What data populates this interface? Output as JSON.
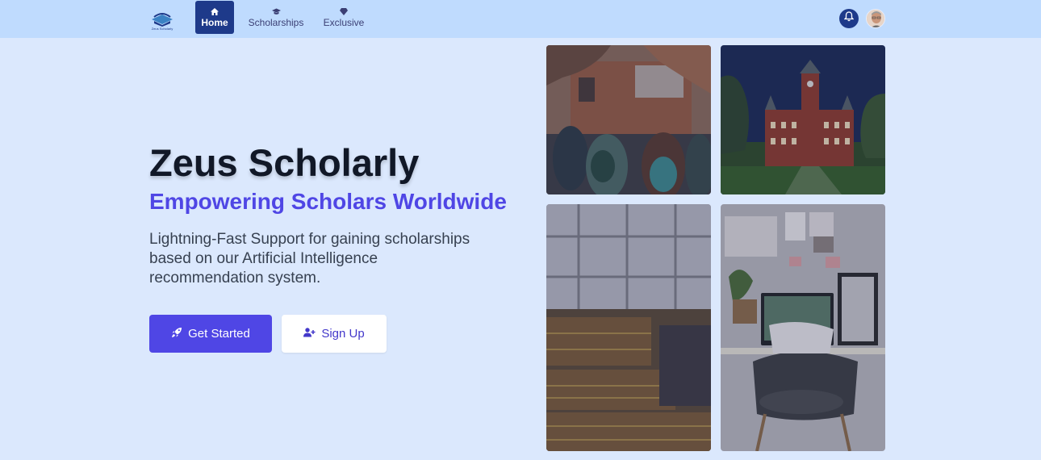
{
  "brand": {
    "logo_text": "Zeus Scholarly"
  },
  "nav": {
    "items": [
      {
        "label": "Home",
        "icon": "home-icon",
        "active": true
      },
      {
        "label": "Scholarships",
        "icon": "graduation-cap-icon",
        "active": false
      },
      {
        "label": "Exclusive",
        "icon": "gem-icon",
        "active": false
      }
    ],
    "notifications_icon": "bell-icon"
  },
  "hero": {
    "title": "Zeus Scholarly",
    "subtitle": "Empowering Scholars Worldwide",
    "description": "Lightning-Fast Support for gaining scholarships based on our Artificial Intelligence recommendation system.",
    "primary_button": {
      "label": "Get Started",
      "icon": "rocket-icon"
    },
    "secondary_button": {
      "label": "Sign Up",
      "icon": "user-plus-icon"
    }
  },
  "gallery": {
    "images": [
      "students-walking-photo",
      "university-building-photo",
      "library-bookshelves-photo",
      "desk-workspace-photo"
    ]
  },
  "colors": {
    "background": "#dbe8fd",
    "navbar": "#bfdbfe",
    "active_nav": "#1e3a8a",
    "accent": "#4f46e5",
    "title": "#111827"
  }
}
